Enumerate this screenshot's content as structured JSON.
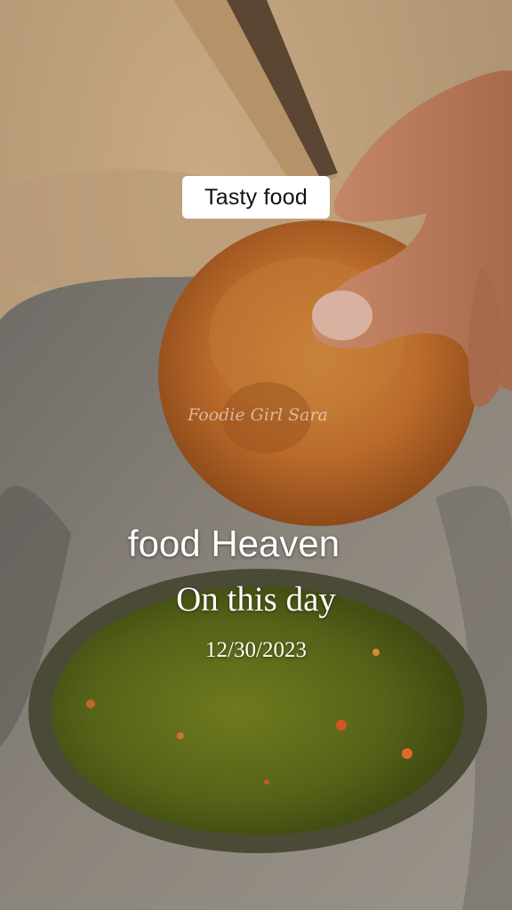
{
  "caption": "Tasty food",
  "watermark": "Foodie Girl Sara",
  "overlay": {
    "title": "food Heaven",
    "subtitle": "On this day",
    "date": "12/30/2023"
  }
}
